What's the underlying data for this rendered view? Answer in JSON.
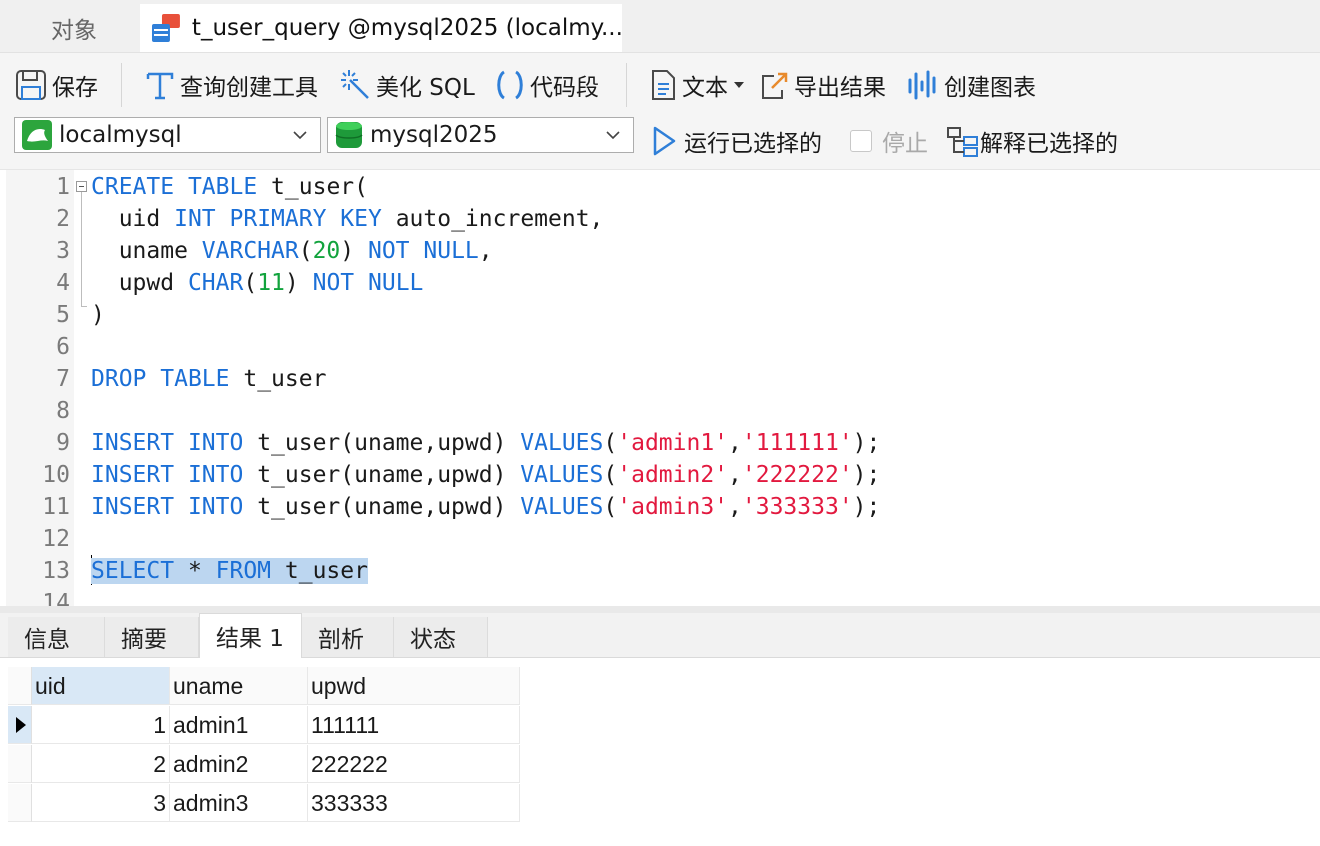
{
  "tabs": {
    "objects": "对象",
    "query": "t_user_query @mysql2025 (localmy..."
  },
  "toolbar": {
    "save": "保存",
    "query_builder": "查询创建工具",
    "beautify": "美化 SQL",
    "snippet": "代码段",
    "text": "文本",
    "export": "导出结果",
    "chart": "创建图表"
  },
  "connection": {
    "server": "localmysql",
    "database": "mysql2025",
    "run_selected": "运行已选择的",
    "stop": "停止",
    "explain_selected": "解释已选择的"
  },
  "editor": {
    "lines": [
      {
        "n": "1",
        "tokens": [
          {
            "t": "CREATE",
            "c": "kw"
          },
          {
            "t": " "
          },
          {
            "t": "TABLE",
            "c": "kw"
          },
          {
            "t": " t_user("
          }
        ]
      },
      {
        "n": "2",
        "tokens": [
          {
            "t": "  uid "
          },
          {
            "t": "INT",
            "c": "kw"
          },
          {
            "t": " "
          },
          {
            "t": "PRIMARY",
            "c": "kw"
          },
          {
            "t": " "
          },
          {
            "t": "KEY",
            "c": "kw"
          },
          {
            "t": " auto_increment,"
          }
        ]
      },
      {
        "n": "3",
        "tokens": [
          {
            "t": "  uname "
          },
          {
            "t": "VARCHAR",
            "c": "kw"
          },
          {
            "t": "("
          },
          {
            "t": "20",
            "c": "num"
          },
          {
            "t": ") "
          },
          {
            "t": "NOT",
            "c": "kw"
          },
          {
            "t": " "
          },
          {
            "t": "NULL",
            "c": "kw"
          },
          {
            "t": ","
          }
        ]
      },
      {
        "n": "4",
        "tokens": [
          {
            "t": "  upwd "
          },
          {
            "t": "CHAR",
            "c": "kw"
          },
          {
            "t": "("
          },
          {
            "t": "11",
            "c": "num"
          },
          {
            "t": ") "
          },
          {
            "t": "NOT",
            "c": "kw"
          },
          {
            "t": " "
          },
          {
            "t": "NULL",
            "c": "kw"
          }
        ]
      },
      {
        "n": "5",
        "tokens": [
          {
            "t": ")"
          }
        ]
      },
      {
        "n": "6",
        "tokens": []
      },
      {
        "n": "7",
        "tokens": [
          {
            "t": "DROP",
            "c": "kw"
          },
          {
            "t": " "
          },
          {
            "t": "TABLE",
            "c": "kw"
          },
          {
            "t": " t_user"
          }
        ]
      },
      {
        "n": "8",
        "tokens": []
      },
      {
        "n": "9",
        "tokens": [
          {
            "t": "INSERT",
            "c": "kw"
          },
          {
            "t": " "
          },
          {
            "t": "INTO",
            "c": "kw"
          },
          {
            "t": " t_user(uname,upwd) "
          },
          {
            "t": "VALUES",
            "c": "kw"
          },
          {
            "t": "("
          },
          {
            "t": "'admin1'",
            "c": "str"
          },
          {
            "t": ","
          },
          {
            "t": "'111111'",
            "c": "str"
          },
          {
            "t": ");"
          }
        ]
      },
      {
        "n": "10",
        "tokens": [
          {
            "t": "INSERT",
            "c": "kw"
          },
          {
            "t": " "
          },
          {
            "t": "INTO",
            "c": "kw"
          },
          {
            "t": " t_user(uname,upwd) "
          },
          {
            "t": "VALUES",
            "c": "kw"
          },
          {
            "t": "("
          },
          {
            "t": "'admin2'",
            "c": "str"
          },
          {
            "t": ","
          },
          {
            "t": "'222222'",
            "c": "str"
          },
          {
            "t": ");"
          }
        ]
      },
      {
        "n": "11",
        "tokens": [
          {
            "t": "INSERT",
            "c": "kw"
          },
          {
            "t": " "
          },
          {
            "t": "INTO",
            "c": "kw"
          },
          {
            "t": " t_user(uname,upwd) "
          },
          {
            "t": "VALUES",
            "c": "kw"
          },
          {
            "t": "("
          },
          {
            "t": "'admin3'",
            "c": "str"
          },
          {
            "t": ","
          },
          {
            "t": "'333333'",
            "c": "str"
          },
          {
            "t": ");"
          }
        ]
      },
      {
        "n": "12",
        "tokens": []
      },
      {
        "n": "13",
        "tokens": [
          {
            "t": "SELECT",
            "c": "kw sel"
          },
          {
            "t": " * ",
            "c": "sel"
          },
          {
            "t": "FROM",
            "c": "kw sel"
          },
          {
            "t": " t_user",
            "c": "sel"
          }
        ]
      },
      {
        "n": "14",
        "tokens": []
      }
    ]
  },
  "result_tabs": {
    "info": "信息",
    "summary": "摘要",
    "result1": "结果 1",
    "profile": "剖析",
    "status": "状态"
  },
  "grid": {
    "columns": [
      "uid",
      "uname",
      "upwd"
    ],
    "rows": [
      [
        "1",
        "admin1",
        "111111"
      ],
      [
        "2",
        "admin2",
        "222222"
      ],
      [
        "3",
        "admin3",
        "333333"
      ]
    ]
  },
  "colors": {
    "keyword": "#1b6fd6",
    "number": "#12a33d",
    "string": "#e2193f",
    "selection": "#bcd6f0"
  }
}
